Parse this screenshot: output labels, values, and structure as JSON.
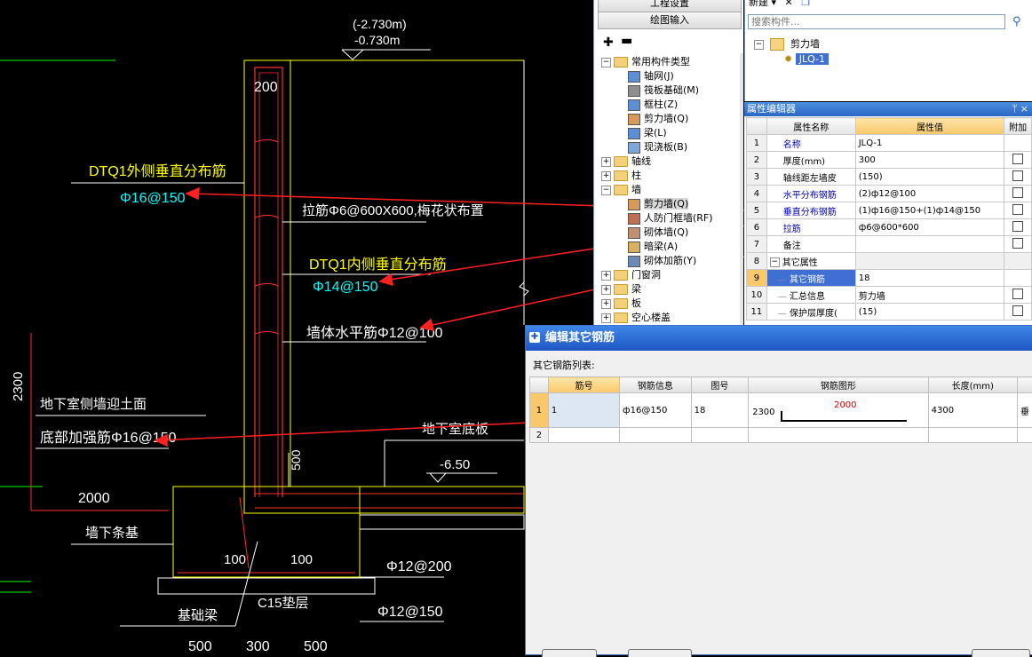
{
  "cad": {
    "elev_top1": "(-2.730m)",
    "elev_top2": "-0.730m",
    "dim_200": "200",
    "label_outer": "DTQ1外侧垂直分布筋",
    "label_outer_val": "Φ16@150",
    "label_tie": "拉筋Φ6@600X600,梅花状布置",
    "label_inner": "DTQ1内侧垂直分布筋",
    "label_inner_val": "Φ14@150",
    "label_horizontal": "墙体水平筋Φ12@100",
    "dim_2300": "2300",
    "label_basement": "地下室侧墙迎土面",
    "label_bottom": "底部加强筋Φ16@150",
    "label_slab": "地下室底板",
    "elev_650": "-6.50",
    "dim_500": "500",
    "dim_2000": "2000",
    "label_strip": "墙下条基",
    "dim_100a": "100",
    "dim_100b": "100",
    "label_phi12_200": "Φ12@200",
    "label_c15": "C15垫层",
    "label_phi12_150": "Φ12@150",
    "label_beam": "基础梁",
    "dim_500a": "500",
    "dim_300": "300",
    "dim_500b": "500",
    "colors": {
      "yellow": "#ffff00",
      "cyan": "#00ffff",
      "white": "#ffffff",
      "red": "#ff0000",
      "green": "#00ff00"
    }
  },
  "leftPanel": {
    "btn_project": "工程设置",
    "btn_draw": "绘图输入",
    "tree": [
      {
        "label": "常用构件类型",
        "icon": "folder-icon",
        "expander": "−"
      },
      {
        "label": "轴网(J)",
        "icon": "grid-icon"
      },
      {
        "label": "筏板基础(M)",
        "icon": "raft-icon"
      },
      {
        "label": "框柱(Z)",
        "icon": "column-icon"
      },
      {
        "label": "剪力墙(Q)",
        "icon": "wall-icon"
      },
      {
        "label": "梁(L)",
        "icon": "beam-icon"
      },
      {
        "label": "现浇板(B)",
        "icon": "slab-icon"
      },
      {
        "label": "轴线",
        "icon": "folder-icon",
        "expander": "+"
      },
      {
        "label": "柱",
        "icon": "folder-icon",
        "expander": "+"
      },
      {
        "label": "墙",
        "icon": "folder-icon",
        "expander": "−"
      },
      {
        "label": "剪力墙(Q)",
        "icon": "wall-icon"
      },
      {
        "label": "人防门框墙(RF)",
        "icon": "door-frame-icon"
      },
      {
        "label": "砌体墙(Q)",
        "icon": "masonry-icon"
      },
      {
        "label": "暗梁(A)",
        "icon": "hidden-beam-icon"
      },
      {
        "label": "砌体加筋(Y)",
        "icon": "masonry-rebar-icon"
      },
      {
        "label": "门窗洞",
        "icon": "folder-icon",
        "expander": "+"
      },
      {
        "label": "梁",
        "icon": "folder-icon",
        "expander": "+"
      },
      {
        "label": "板",
        "icon": "folder-icon",
        "expander": "+"
      },
      {
        "label": "空心楼盖",
        "icon": "folder-icon",
        "expander": "+"
      }
    ]
  },
  "rightTop": {
    "new_btn": "新建",
    "search_placeholder": "搜索构件...",
    "tree_root": "剪力墙",
    "tree_child": "JLQ-1"
  },
  "propEditor": {
    "title": "属性编辑器",
    "pin": "ꟷ",
    "close": "×",
    "headers": [
      "属性名称",
      "属性值",
      "附加"
    ],
    "rows": [
      {
        "n": "1",
        "name": "名称",
        "value": "JLQ-1",
        "blue": true,
        "chk": false
      },
      {
        "n": "2",
        "name": "厚度(mm)",
        "value": "300",
        "blue": false,
        "chk": true
      },
      {
        "n": "3",
        "name": "轴线距左墙皮",
        "value": "(150)",
        "blue": false,
        "chk": true
      },
      {
        "n": "4",
        "name": "水平分布钢筋",
        "value": "(2)ф12@100",
        "blue": true,
        "chk": true
      },
      {
        "n": "5",
        "name": "垂直分布钢筋",
        "value": "(1)ф16@150+(1)ф14@150",
        "blue": true,
        "chk": true
      },
      {
        "n": "6",
        "name": "拉筋",
        "value": "ф6@600*600",
        "blue": true,
        "chk": true
      },
      {
        "n": "7",
        "name": "备注",
        "value": "",
        "blue": false,
        "chk": true
      },
      {
        "n": "8",
        "name": "其它属性",
        "value": "",
        "blue": false,
        "chk": false,
        "group": true
      },
      {
        "n": "9",
        "name": "其它钢筋",
        "value": "18",
        "blue": false,
        "chk": false,
        "selected": true
      },
      {
        "n": "10",
        "name": "汇总信息",
        "value": "剪力墙",
        "blue": false,
        "chk": true
      },
      {
        "n": "11",
        "name": "保护层厚度(",
        "value": "(15)",
        "blue": false,
        "chk": true
      }
    ]
  },
  "dialog": {
    "title": "编辑其它钢筋",
    "list_label": "其它钢筋列表:",
    "headers": [
      "筋号",
      "钢筋信息",
      "图号",
      "钢筋图形",
      "长度(mm)"
    ],
    "rows": [
      {
        "n": "1",
        "bar_no": "1",
        "info": "ф16@150",
        "fig": "18",
        "shape_left": "2300",
        "shape_top": "2000",
        "length": "4300",
        "extra": "垂"
      },
      {
        "n": "2",
        "bar_no": "",
        "info": "",
        "fig": "",
        "shape_left": "",
        "shape_top": "",
        "length": "",
        "extra": ""
      }
    ]
  }
}
